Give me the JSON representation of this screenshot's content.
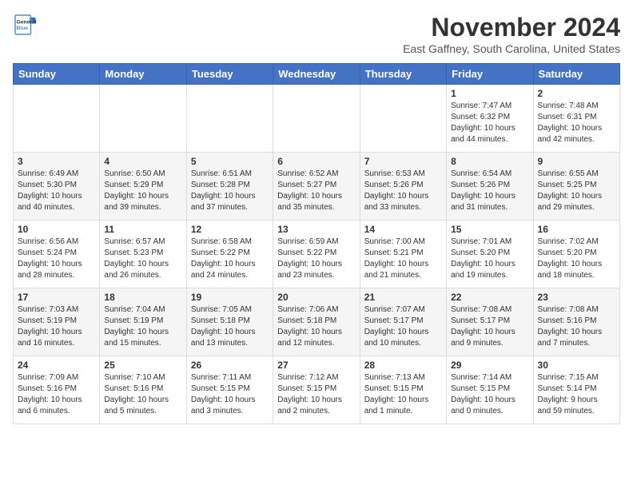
{
  "header": {
    "logo_line1": "General",
    "logo_line2": "Blue",
    "month": "November 2024",
    "location": "East Gaffney, South Carolina, United States"
  },
  "weekdays": [
    "Sunday",
    "Monday",
    "Tuesday",
    "Wednesday",
    "Thursday",
    "Friday",
    "Saturday"
  ],
  "weeks": [
    [
      {
        "day": "",
        "info": ""
      },
      {
        "day": "",
        "info": ""
      },
      {
        "day": "",
        "info": ""
      },
      {
        "day": "",
        "info": ""
      },
      {
        "day": "",
        "info": ""
      },
      {
        "day": "1",
        "info": "Sunrise: 7:47 AM\nSunset: 6:32 PM\nDaylight: 10 hours\nand 44 minutes."
      },
      {
        "day": "2",
        "info": "Sunrise: 7:48 AM\nSunset: 6:31 PM\nDaylight: 10 hours\nand 42 minutes."
      }
    ],
    [
      {
        "day": "3",
        "info": "Sunrise: 6:49 AM\nSunset: 5:30 PM\nDaylight: 10 hours\nand 40 minutes."
      },
      {
        "day": "4",
        "info": "Sunrise: 6:50 AM\nSunset: 5:29 PM\nDaylight: 10 hours\nand 39 minutes."
      },
      {
        "day": "5",
        "info": "Sunrise: 6:51 AM\nSunset: 5:28 PM\nDaylight: 10 hours\nand 37 minutes."
      },
      {
        "day": "6",
        "info": "Sunrise: 6:52 AM\nSunset: 5:27 PM\nDaylight: 10 hours\nand 35 minutes."
      },
      {
        "day": "7",
        "info": "Sunrise: 6:53 AM\nSunset: 5:26 PM\nDaylight: 10 hours\nand 33 minutes."
      },
      {
        "day": "8",
        "info": "Sunrise: 6:54 AM\nSunset: 5:26 PM\nDaylight: 10 hours\nand 31 minutes."
      },
      {
        "day": "9",
        "info": "Sunrise: 6:55 AM\nSunset: 5:25 PM\nDaylight: 10 hours\nand 29 minutes."
      }
    ],
    [
      {
        "day": "10",
        "info": "Sunrise: 6:56 AM\nSunset: 5:24 PM\nDaylight: 10 hours\nand 28 minutes."
      },
      {
        "day": "11",
        "info": "Sunrise: 6:57 AM\nSunset: 5:23 PM\nDaylight: 10 hours\nand 26 minutes."
      },
      {
        "day": "12",
        "info": "Sunrise: 6:58 AM\nSunset: 5:22 PM\nDaylight: 10 hours\nand 24 minutes."
      },
      {
        "day": "13",
        "info": "Sunrise: 6:59 AM\nSunset: 5:22 PM\nDaylight: 10 hours\nand 23 minutes."
      },
      {
        "day": "14",
        "info": "Sunrise: 7:00 AM\nSunset: 5:21 PM\nDaylight: 10 hours\nand 21 minutes."
      },
      {
        "day": "15",
        "info": "Sunrise: 7:01 AM\nSunset: 5:20 PM\nDaylight: 10 hours\nand 19 minutes."
      },
      {
        "day": "16",
        "info": "Sunrise: 7:02 AM\nSunset: 5:20 PM\nDaylight: 10 hours\nand 18 minutes."
      }
    ],
    [
      {
        "day": "17",
        "info": "Sunrise: 7:03 AM\nSunset: 5:19 PM\nDaylight: 10 hours\nand 16 minutes."
      },
      {
        "day": "18",
        "info": "Sunrise: 7:04 AM\nSunset: 5:19 PM\nDaylight: 10 hours\nand 15 minutes."
      },
      {
        "day": "19",
        "info": "Sunrise: 7:05 AM\nSunset: 5:18 PM\nDaylight: 10 hours\nand 13 minutes."
      },
      {
        "day": "20",
        "info": "Sunrise: 7:06 AM\nSunset: 5:18 PM\nDaylight: 10 hours\nand 12 minutes."
      },
      {
        "day": "21",
        "info": "Sunrise: 7:07 AM\nSunset: 5:17 PM\nDaylight: 10 hours\nand 10 minutes."
      },
      {
        "day": "22",
        "info": "Sunrise: 7:08 AM\nSunset: 5:17 PM\nDaylight: 10 hours\nand 9 minutes."
      },
      {
        "day": "23",
        "info": "Sunrise: 7:08 AM\nSunset: 5:16 PM\nDaylight: 10 hours\nand 7 minutes."
      }
    ],
    [
      {
        "day": "24",
        "info": "Sunrise: 7:09 AM\nSunset: 5:16 PM\nDaylight: 10 hours\nand 6 minutes."
      },
      {
        "day": "25",
        "info": "Sunrise: 7:10 AM\nSunset: 5:16 PM\nDaylight: 10 hours\nand 5 minutes."
      },
      {
        "day": "26",
        "info": "Sunrise: 7:11 AM\nSunset: 5:15 PM\nDaylight: 10 hours\nand 3 minutes."
      },
      {
        "day": "27",
        "info": "Sunrise: 7:12 AM\nSunset: 5:15 PM\nDaylight: 10 hours\nand 2 minutes."
      },
      {
        "day": "28",
        "info": "Sunrise: 7:13 AM\nSunset: 5:15 PM\nDaylight: 10 hours\nand 1 minute."
      },
      {
        "day": "29",
        "info": "Sunrise: 7:14 AM\nSunset: 5:15 PM\nDaylight: 10 hours\nand 0 minutes."
      },
      {
        "day": "30",
        "info": "Sunrise: 7:15 AM\nSunset: 5:14 PM\nDaylight: 9 hours\nand 59 minutes."
      }
    ]
  ]
}
